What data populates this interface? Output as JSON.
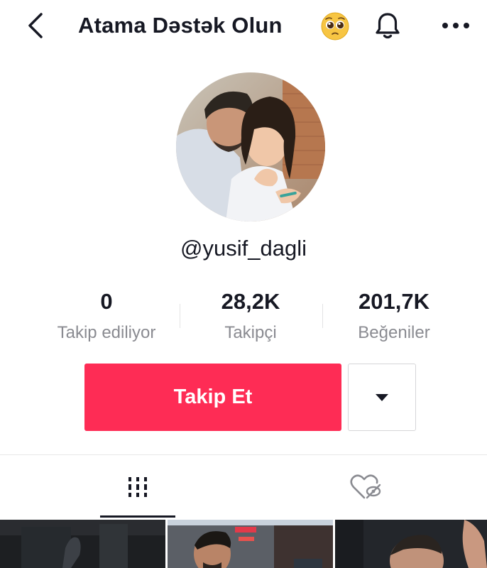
{
  "header": {
    "title": "Atama Dəstək Olun",
    "back_icon": "chevron-left-icon",
    "title_emoji": "pleading-face-emoji",
    "notification_icon": "bell-icon",
    "more_icon": "more-horizontal-icon"
  },
  "profile": {
    "username": "@yusif_dagli",
    "avatar": "avatar-photo"
  },
  "stats": [
    {
      "value": "0",
      "label": "Takip ediliyor"
    },
    {
      "value": "28,2K",
      "label": "Takipçi"
    },
    {
      "value": "201,7K",
      "label": "Beğeniler"
    }
  ],
  "actions": {
    "follow_label": "Takip Et",
    "dropdown_icon": "caret-down-icon"
  },
  "tabs": [
    {
      "icon": "videos-grid-icon",
      "active": true
    },
    {
      "icon": "liked-hidden-icon",
      "active": false
    }
  ],
  "colors": {
    "accent": "#fe2c55",
    "text": "#161823",
    "secondary_text": "#8a8b91"
  }
}
